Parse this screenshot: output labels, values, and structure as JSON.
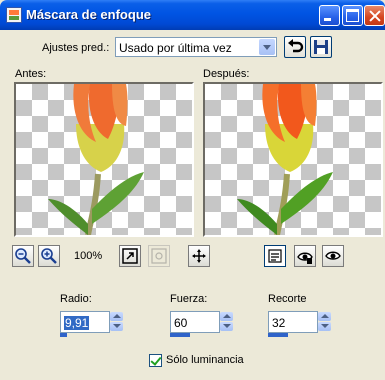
{
  "window": {
    "title": "Máscara de enfoque"
  },
  "presets": {
    "label": "Ajustes pred.:",
    "value": "Usado por última vez"
  },
  "preview": {
    "before_label": "Antes:",
    "after_label": "Después:",
    "zoom": "100%"
  },
  "fields": {
    "radius": {
      "label": "Radio:",
      "value": "9,91",
      "fill": 0.1
    },
    "strength": {
      "label": "Fuerza:",
      "value": "60",
      "fill": 0.3
    },
    "clip": {
      "label": "Recorte",
      "value": "32",
      "fill": 0.3
    }
  },
  "luminance": {
    "label": "Sólo luminancia",
    "checked": true
  },
  "icons": {
    "app": "mask-icon",
    "minimize": "minimize-icon",
    "maximize": "maximize-icon",
    "close": "close-icon",
    "reset": "undo-arrow-icon",
    "save": "floppy-disk-icon",
    "zoom_out": "zoom-out-icon",
    "zoom_in": "zoom-in-icon",
    "fit": "fit-window-icon",
    "actual": "actual-size-icon",
    "pan": "move-icon",
    "preview": "preview-toggle-icon",
    "proof": "proof-icon",
    "eye": "eye-icon"
  },
  "colors": {
    "titlebar": "#0054e3",
    "accent": "#316ac5",
    "dialog": "#ece9d8"
  }
}
